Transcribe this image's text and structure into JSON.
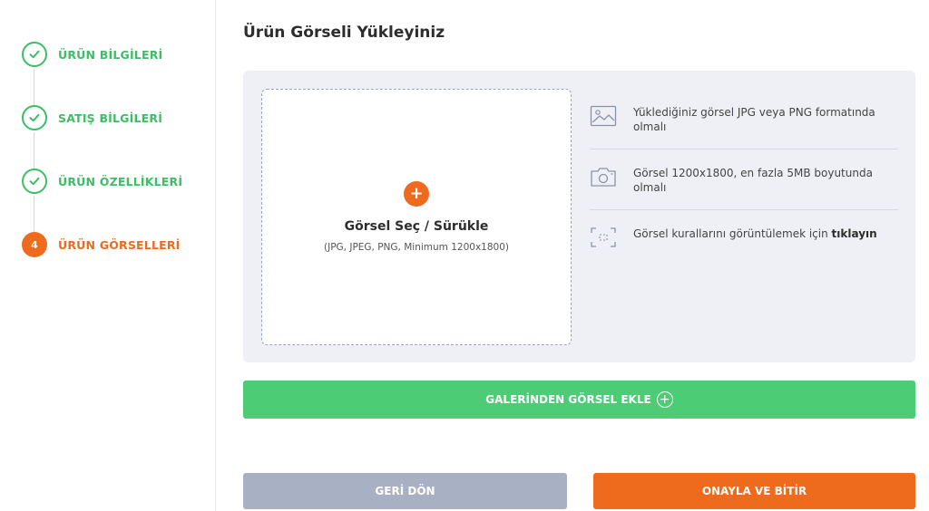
{
  "steps": [
    {
      "label": "ÜRÜN BİLGİLERİ",
      "state": "done"
    },
    {
      "label": "SATIŞ BİLGİLERİ",
      "state": "done"
    },
    {
      "label": "ÜRÜN ÖZELLİKLERİ",
      "state": "done"
    },
    {
      "label": "ÜRÜN GÖRSELLERİ",
      "state": "active",
      "number": "4"
    }
  ],
  "page": {
    "title": "Ürün Görseli Yükleyiniz"
  },
  "dropzone": {
    "plus": "+",
    "title": "Görsel Seç / Sürükle",
    "subtitle": "(JPG, JPEG, PNG, Minimum 1200x1800)"
  },
  "rules": [
    {
      "icon": "image-icon",
      "text": "Yüklediğiniz görsel JPG veya PNG formatında olmalı"
    },
    {
      "icon": "camera-icon",
      "text": "Görsel 1200x1800, en fazla 5MB boyutunda olmalı"
    },
    {
      "icon": "frame-icon",
      "text": "Görsel kurallarını görüntülemek için ",
      "link": "tıklayın"
    }
  ],
  "buttons": {
    "gallery": "GALERİNDEN GÖRSEL EKLE",
    "back": "GERİ DÖN",
    "confirm": "ONAYLA VE BİTİR"
  },
  "colors": {
    "success": "#3cbf64",
    "accent": "#ee6a1c",
    "green_button": "#4ccc75",
    "muted_button": "#a8b1c4"
  }
}
